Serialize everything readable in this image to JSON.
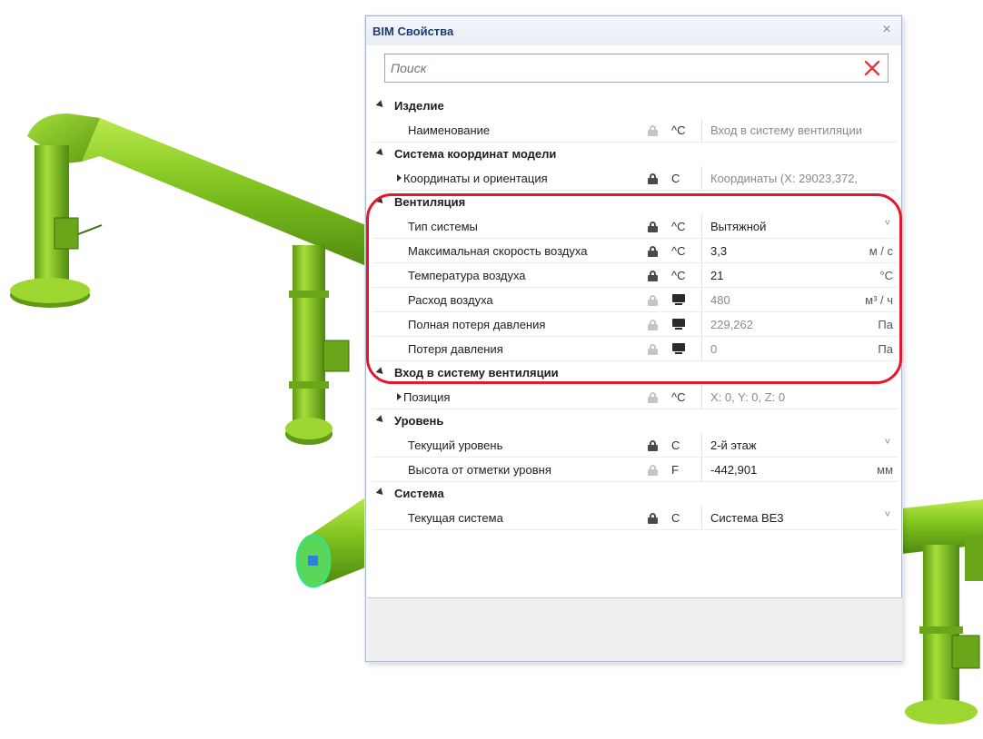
{
  "panel": {
    "title": "BIM Свойства",
    "close_symbol": "×",
    "search": {
      "placeholder": "Поиск",
      "value": ""
    }
  },
  "groups": [
    {
      "label": "Изделие",
      "rows": [
        {
          "label": "Наименование",
          "expandable": false,
          "lock": "light",
          "code": "^C",
          "value": "Вход в систему вентиляции",
          "readonly": true,
          "unit": "",
          "dropdown": false
        }
      ]
    },
    {
      "label": "Система координат модели",
      "rows": [
        {
          "label": "Координаты и ориентация",
          "expandable": true,
          "lock": "dark",
          "code": "C",
          "value": "Координаты (X: 29023,372,",
          "readonly": true,
          "unit": "",
          "dropdown": false
        }
      ]
    },
    {
      "label": "Вентиляция",
      "rows": [
        {
          "label": "Тип системы",
          "expandable": false,
          "lock": "dark",
          "code": "^C",
          "value": "Вытяжной",
          "readonly": false,
          "unit": "",
          "dropdown": true
        },
        {
          "label": "Максимальная скорость воздуха",
          "expandable": false,
          "lock": "dark",
          "code": "^C",
          "value": "3,3",
          "readonly": false,
          "unit": "м / с",
          "dropdown": false
        },
        {
          "label": "Температура воздуха",
          "expandable": false,
          "lock": "dark",
          "code": "^C",
          "value": "21",
          "readonly": false,
          "unit": "°С",
          "dropdown": false
        },
        {
          "label": "Расход воздуха",
          "expandable": false,
          "lock": "light",
          "code": "monitor",
          "value": "480",
          "readonly": true,
          "unit": "м³ / ч",
          "dropdown": false
        },
        {
          "label": "Полная потеря давления",
          "expandable": false,
          "lock": "light",
          "code": "monitor",
          "value": "229,262",
          "readonly": true,
          "unit": "Па",
          "dropdown": false
        },
        {
          "label": "Потеря давления",
          "expandable": false,
          "lock": "light",
          "code": "monitor",
          "value": "0",
          "readonly": true,
          "unit": "Па",
          "dropdown": false
        }
      ]
    },
    {
      "label": "Вход в систему вентиляции",
      "rows": [
        {
          "label": "Позиция",
          "expandable": true,
          "lock": "light",
          "code": "^C",
          "value": "X: 0, Y: 0, Z: 0",
          "readonly": true,
          "unit": "",
          "dropdown": false
        }
      ]
    },
    {
      "label": "Уровень",
      "rows": [
        {
          "label": "Текущий уровень",
          "expandable": false,
          "lock": "dark",
          "code": "C",
          "value": "2-й этаж",
          "readonly": false,
          "unit": "",
          "dropdown": true
        },
        {
          "label": "Высота от отметки уровня",
          "expandable": false,
          "lock": "light",
          "code": "F",
          "value": "-442,901",
          "readonly": false,
          "unit": "мм",
          "dropdown": false
        }
      ]
    },
    {
      "label": "Система",
      "rows": [
        {
          "label": "Текущая система",
          "expandable": false,
          "lock": "dark",
          "code": "C",
          "value": "Система ВЕ3",
          "readonly": false,
          "unit": "",
          "dropdown": true
        }
      ]
    }
  ],
  "colors": {
    "pipe": "#7fc21f",
    "pipe_dark": "#5e9a14",
    "highlight": "#e3182d",
    "selection": "#2f7fe0"
  }
}
